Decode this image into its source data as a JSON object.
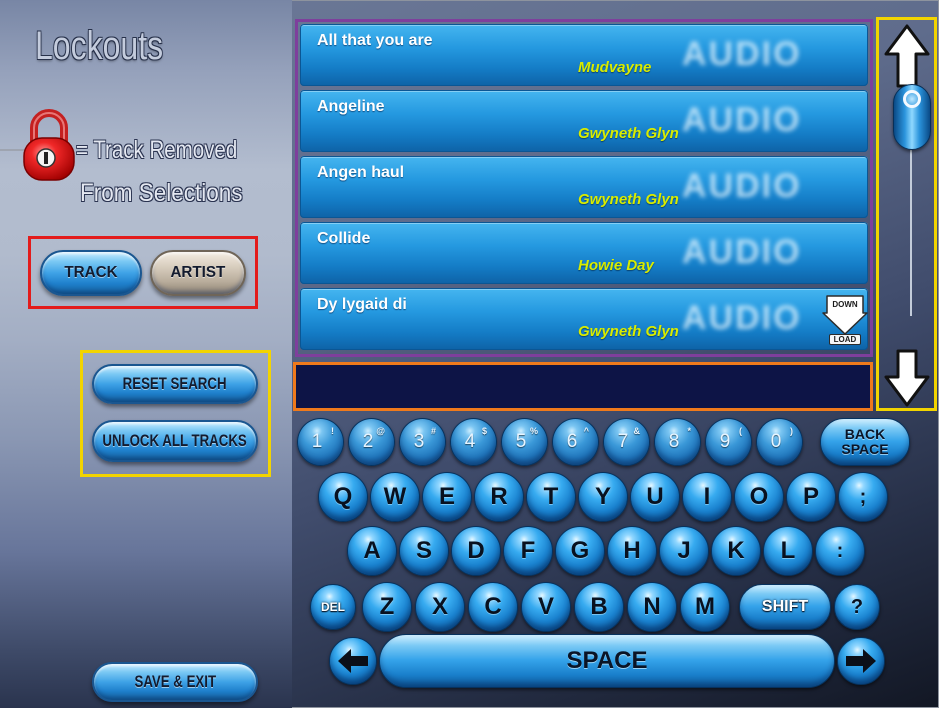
{
  "screen": {
    "title": "Lockouts"
  },
  "legend": {
    "line1": "= Track Removed",
    "line2": "From Selections",
    "icon": "lock-icon"
  },
  "mode_toggle": {
    "track_label": "TRACK",
    "artist_label": "ARTIST",
    "selected": "track"
  },
  "actions": {
    "reset_search": "RESET SEARCH",
    "unlock_all": "UNLOCK ALL TRACKS",
    "save_exit": "SAVE & EXIT"
  },
  "tracks": [
    {
      "title": "All that you are",
      "artist": "Mudvayne",
      "media": "AUDIO"
    },
    {
      "title": "Angeline",
      "artist": "Gwyneth Glyn",
      "media": "AUDIO"
    },
    {
      "title": "Angen haul",
      "artist": "Gwyneth Glyn",
      "media": "AUDIO"
    },
    {
      "title": "Collide",
      "artist": "Howie Day",
      "media": "AUDIO"
    },
    {
      "title": "Dy lygaid di",
      "artist": "Gwyneth Glyn",
      "media": "AUDIO",
      "download": {
        "top": "DOWN",
        "bottom": "LOAD",
        "icon": "download-icon"
      }
    }
  ],
  "search": {
    "value": ""
  },
  "scrollbar": {
    "up_icon": "arrow-up-icon",
    "down_icon": "arrow-down-icon",
    "position": 0
  },
  "keyboard": {
    "numbers": [
      {
        "key": "1",
        "shift": "!"
      },
      {
        "key": "2",
        "shift": "@"
      },
      {
        "key": "3",
        "shift": "#"
      },
      {
        "key": "4",
        "shift": "$"
      },
      {
        "key": "5",
        "shift": "%"
      },
      {
        "key": "6",
        "shift": "^"
      },
      {
        "key": "7",
        "shift": "&"
      },
      {
        "key": "8",
        "shift": "*"
      },
      {
        "key": "9",
        "shift": "("
      },
      {
        "key": "0",
        "shift": ")"
      }
    ],
    "backspace": {
      "line1": "BACK",
      "line2": "SPACE"
    },
    "row_top": [
      "Q",
      "W",
      "E",
      "R",
      "T",
      "Y",
      "U",
      "I",
      "O",
      "P",
      ";"
    ],
    "row_middle": [
      "A",
      "S",
      "D",
      "F",
      "G",
      "H",
      "J",
      "K",
      "L",
      ":"
    ],
    "row_bottom": [
      "Z",
      "X",
      "C",
      "V",
      "B",
      "N",
      "M"
    ],
    "delete": "DEL",
    "shift": "SHIFT",
    "question": "?",
    "space": "SPACE",
    "cursor_left_icon": "arrow-left-icon",
    "cursor_right_icon": "arrow-right-icon"
  },
  "colors": {
    "list_outline": "#7e3f9c",
    "highlight_yellow": "#f2d400",
    "highlight_red": "#e31b1b",
    "highlight_orange": "#ef7a1c",
    "row_blue": "#1f95dc",
    "artist_text": "#d8ec00",
    "search_fill": "#0d1446",
    "lock_red": "#f02828"
  }
}
